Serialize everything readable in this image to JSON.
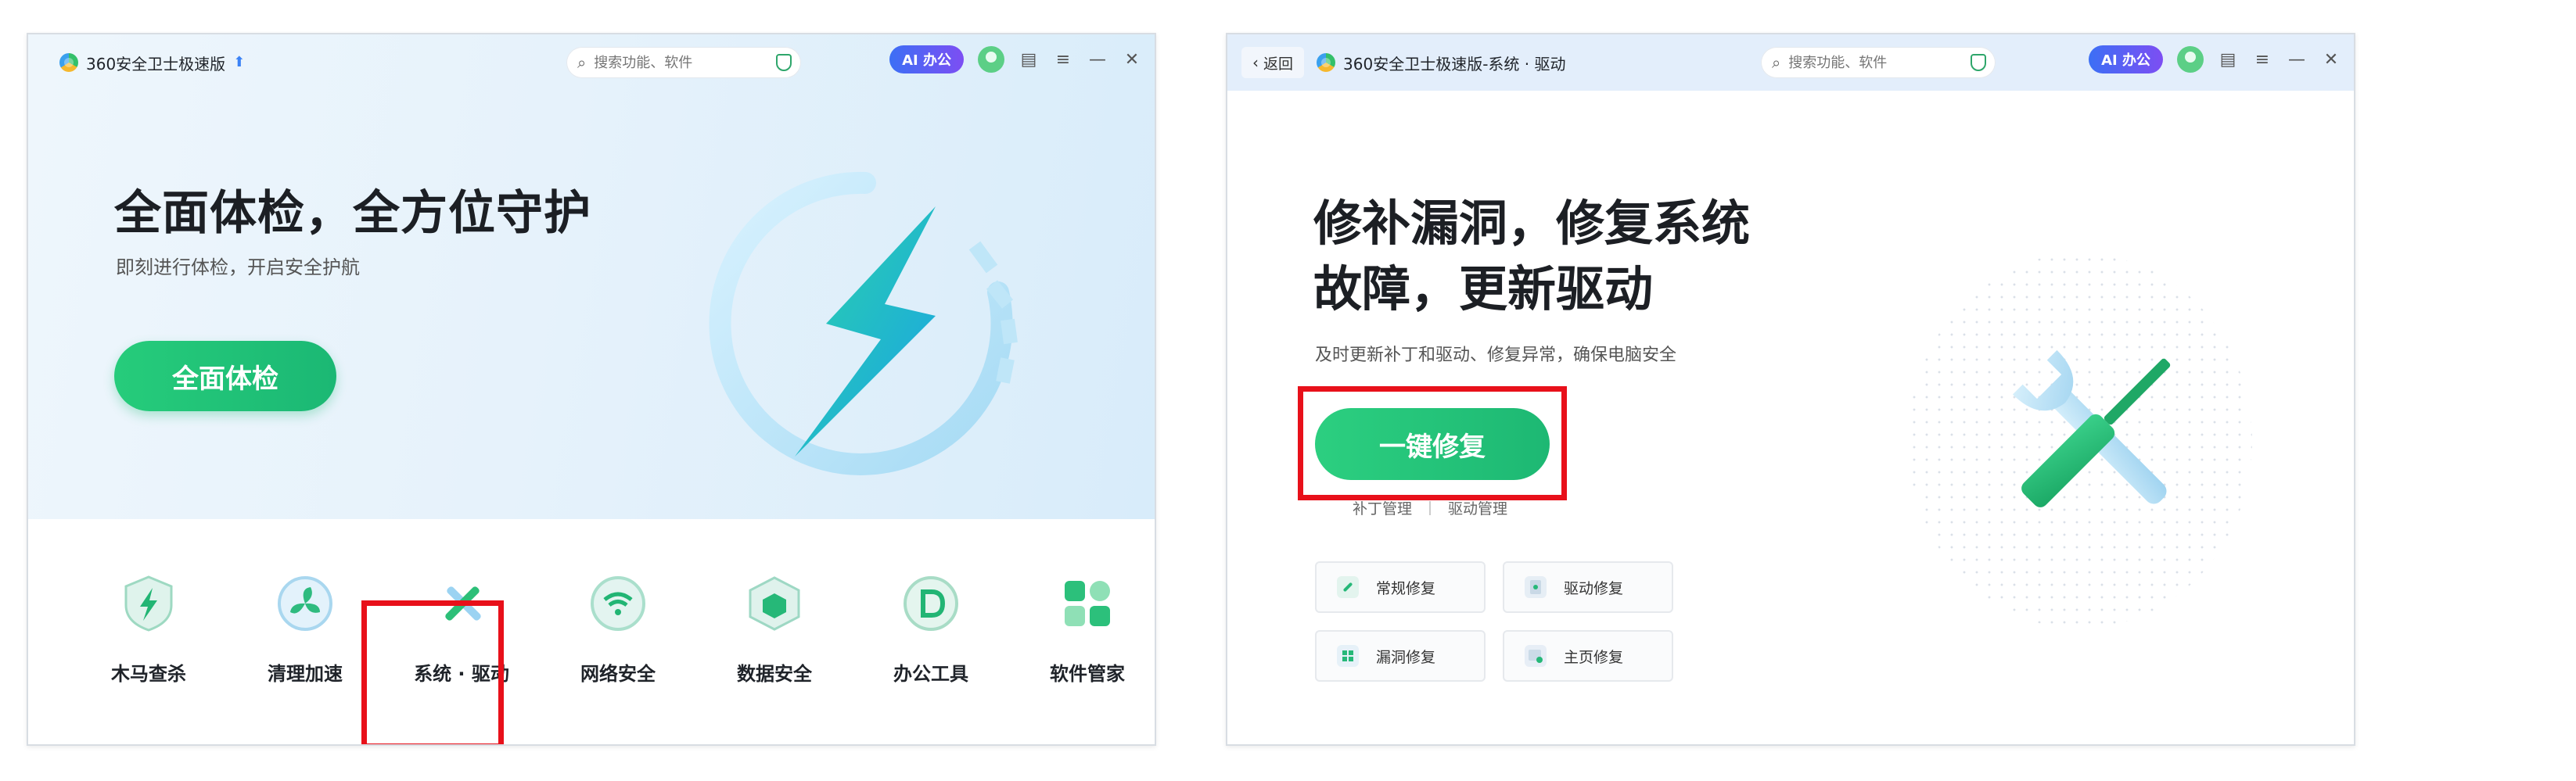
{
  "left_window": {
    "title": "360安全卫士极速版",
    "search_placeholder": "搜索功能、软件",
    "ai_label": "AI 办公",
    "hero_title": "全面体检，全方位守护",
    "hero_subtitle": "即刻进行体检，开启安全护航",
    "hero_button": "全面体检",
    "tools": [
      {
        "label": "木马查杀"
      },
      {
        "label": "清理加速"
      },
      {
        "label": "系统 · 驱动"
      },
      {
        "label": "网络安全"
      },
      {
        "label": "数据安全"
      },
      {
        "label": "办公工具"
      },
      {
        "label": "软件管家"
      }
    ]
  },
  "right_window": {
    "back_label": "返回",
    "title": "360安全卫士极速版-系统 · 驱动",
    "search_placeholder": "搜索功能、软件",
    "ai_label": "AI 办公",
    "main_title_line1": "修补漏洞，修复系统",
    "main_title_line2": "故障，更新驱动",
    "main_subtitle": "及时更新补丁和驱动、修复异常，确保电脑安全",
    "fix_button": "一键修复",
    "link_patch": "补丁管理",
    "link_driver": "驱动管理",
    "cards": [
      {
        "label": "常规修复"
      },
      {
        "label": "驱动修复"
      },
      {
        "label": "漏洞修复"
      },
      {
        "label": "主页修复"
      }
    ]
  },
  "colors": {
    "accent_green": "#1db873",
    "highlight_red": "#e8101a",
    "ai_gradient_start": "#3c6ff5",
    "ai_gradient_end": "#7d4ef3"
  }
}
